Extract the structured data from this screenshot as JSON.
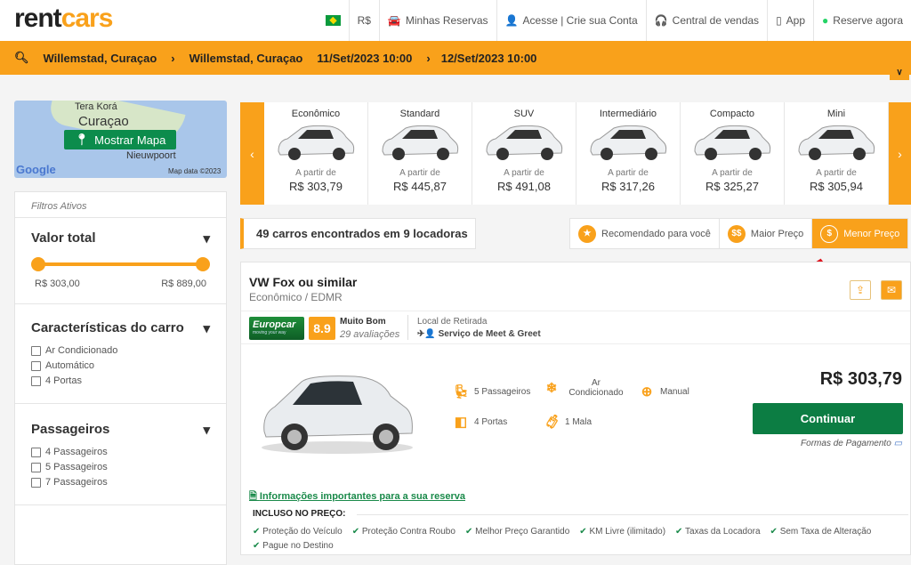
{
  "header": {
    "logo": "rentcars",
    "logo_a": "rent",
    "logo_b": "cars",
    "currency": "R$",
    "my_bookings": "Minhas Reservas",
    "login": "Acesse | Crie sua Conta",
    "sales": "Central de vendas",
    "app": "App",
    "book_now": "Reserve agora"
  },
  "search": {
    "pickup": "Willemstad, Curaçao",
    "dropoff": "Willemstad, Curaçao",
    "start": "11/Set/2023 10:00",
    "end": "12/Set/2023 10:00"
  },
  "map": {
    "label1": "Tera Korá",
    "label2": "Curaçao",
    "label3": "Nieuwpoort",
    "button": "Mostrar Mapa",
    "google": "Google",
    "credit": "Map data ©2023"
  },
  "filters": {
    "active": "Filtros Ativos",
    "total": {
      "title": "Valor total",
      "min": "R$ 303,00",
      "max": "R$ 889,00"
    },
    "features": {
      "title": "Características do carro",
      "options": [
        "Ar Condicionado",
        "Automático",
        "4 Portas"
      ]
    },
    "passengers": {
      "title": "Passageiros",
      "options": [
        "4 Passageiros",
        "5 Passageiros",
        "7 Passageiros"
      ]
    }
  },
  "categories": [
    {
      "name": "Econômico",
      "from": "A partir de",
      "price": "R$ 303,79"
    },
    {
      "name": "Standard",
      "from": "A partir de",
      "price": "R$ 445,87"
    },
    {
      "name": "SUV",
      "from": "A partir de",
      "price": "R$ 491,08"
    },
    {
      "name": "Intermediário",
      "from": "A partir de",
      "price": "R$ 317,26"
    },
    {
      "name": "Compacto",
      "from": "A partir de",
      "price": "R$ 325,27"
    },
    {
      "name": "Mini",
      "from": "A partir de",
      "price": "R$ 305,94"
    }
  ],
  "results": {
    "count": "49 carros encontrados em 9 locadoras"
  },
  "sort": [
    {
      "label": "Recomendado para você",
      "icon": "★"
    },
    {
      "label": "Maior Preço",
      "icon": "$$"
    },
    {
      "label": "Menor Preço",
      "icon": "$",
      "active": true
    }
  ],
  "car": {
    "title": "VW Fox ou similar",
    "category": "Econômico / EDMR",
    "vendor": "Europcar",
    "vendor_tag": "moving your way",
    "score": "8.9",
    "rating": "Muito Bom",
    "reviews": "29 avaliações",
    "pickup_label": "Local de Retirada",
    "pickup_value": "Serviço de Meet & Greet",
    "features": [
      "5 Passageiros",
      "Ar Condicionado",
      "Manual",
      "4 Portas",
      "1 Mala"
    ],
    "price": "R$ 303,79",
    "continue": "Continuar",
    "payment": "Formas de Pagamento",
    "info": "Informações importantes para a sua reserva",
    "included_title": "INCLUSO NO PREÇO:",
    "included": [
      "Proteção do Veículo",
      "Proteção Contra Roubo",
      "Melhor Preço Garantido",
      "KM Livre (ilimitado)",
      "Taxas da Locadora",
      "Sem Taxa de Alteração",
      "Pague no Destino"
    ]
  },
  "colors": {
    "accent": "#f9a11b",
    "green": "#0c7d43"
  }
}
